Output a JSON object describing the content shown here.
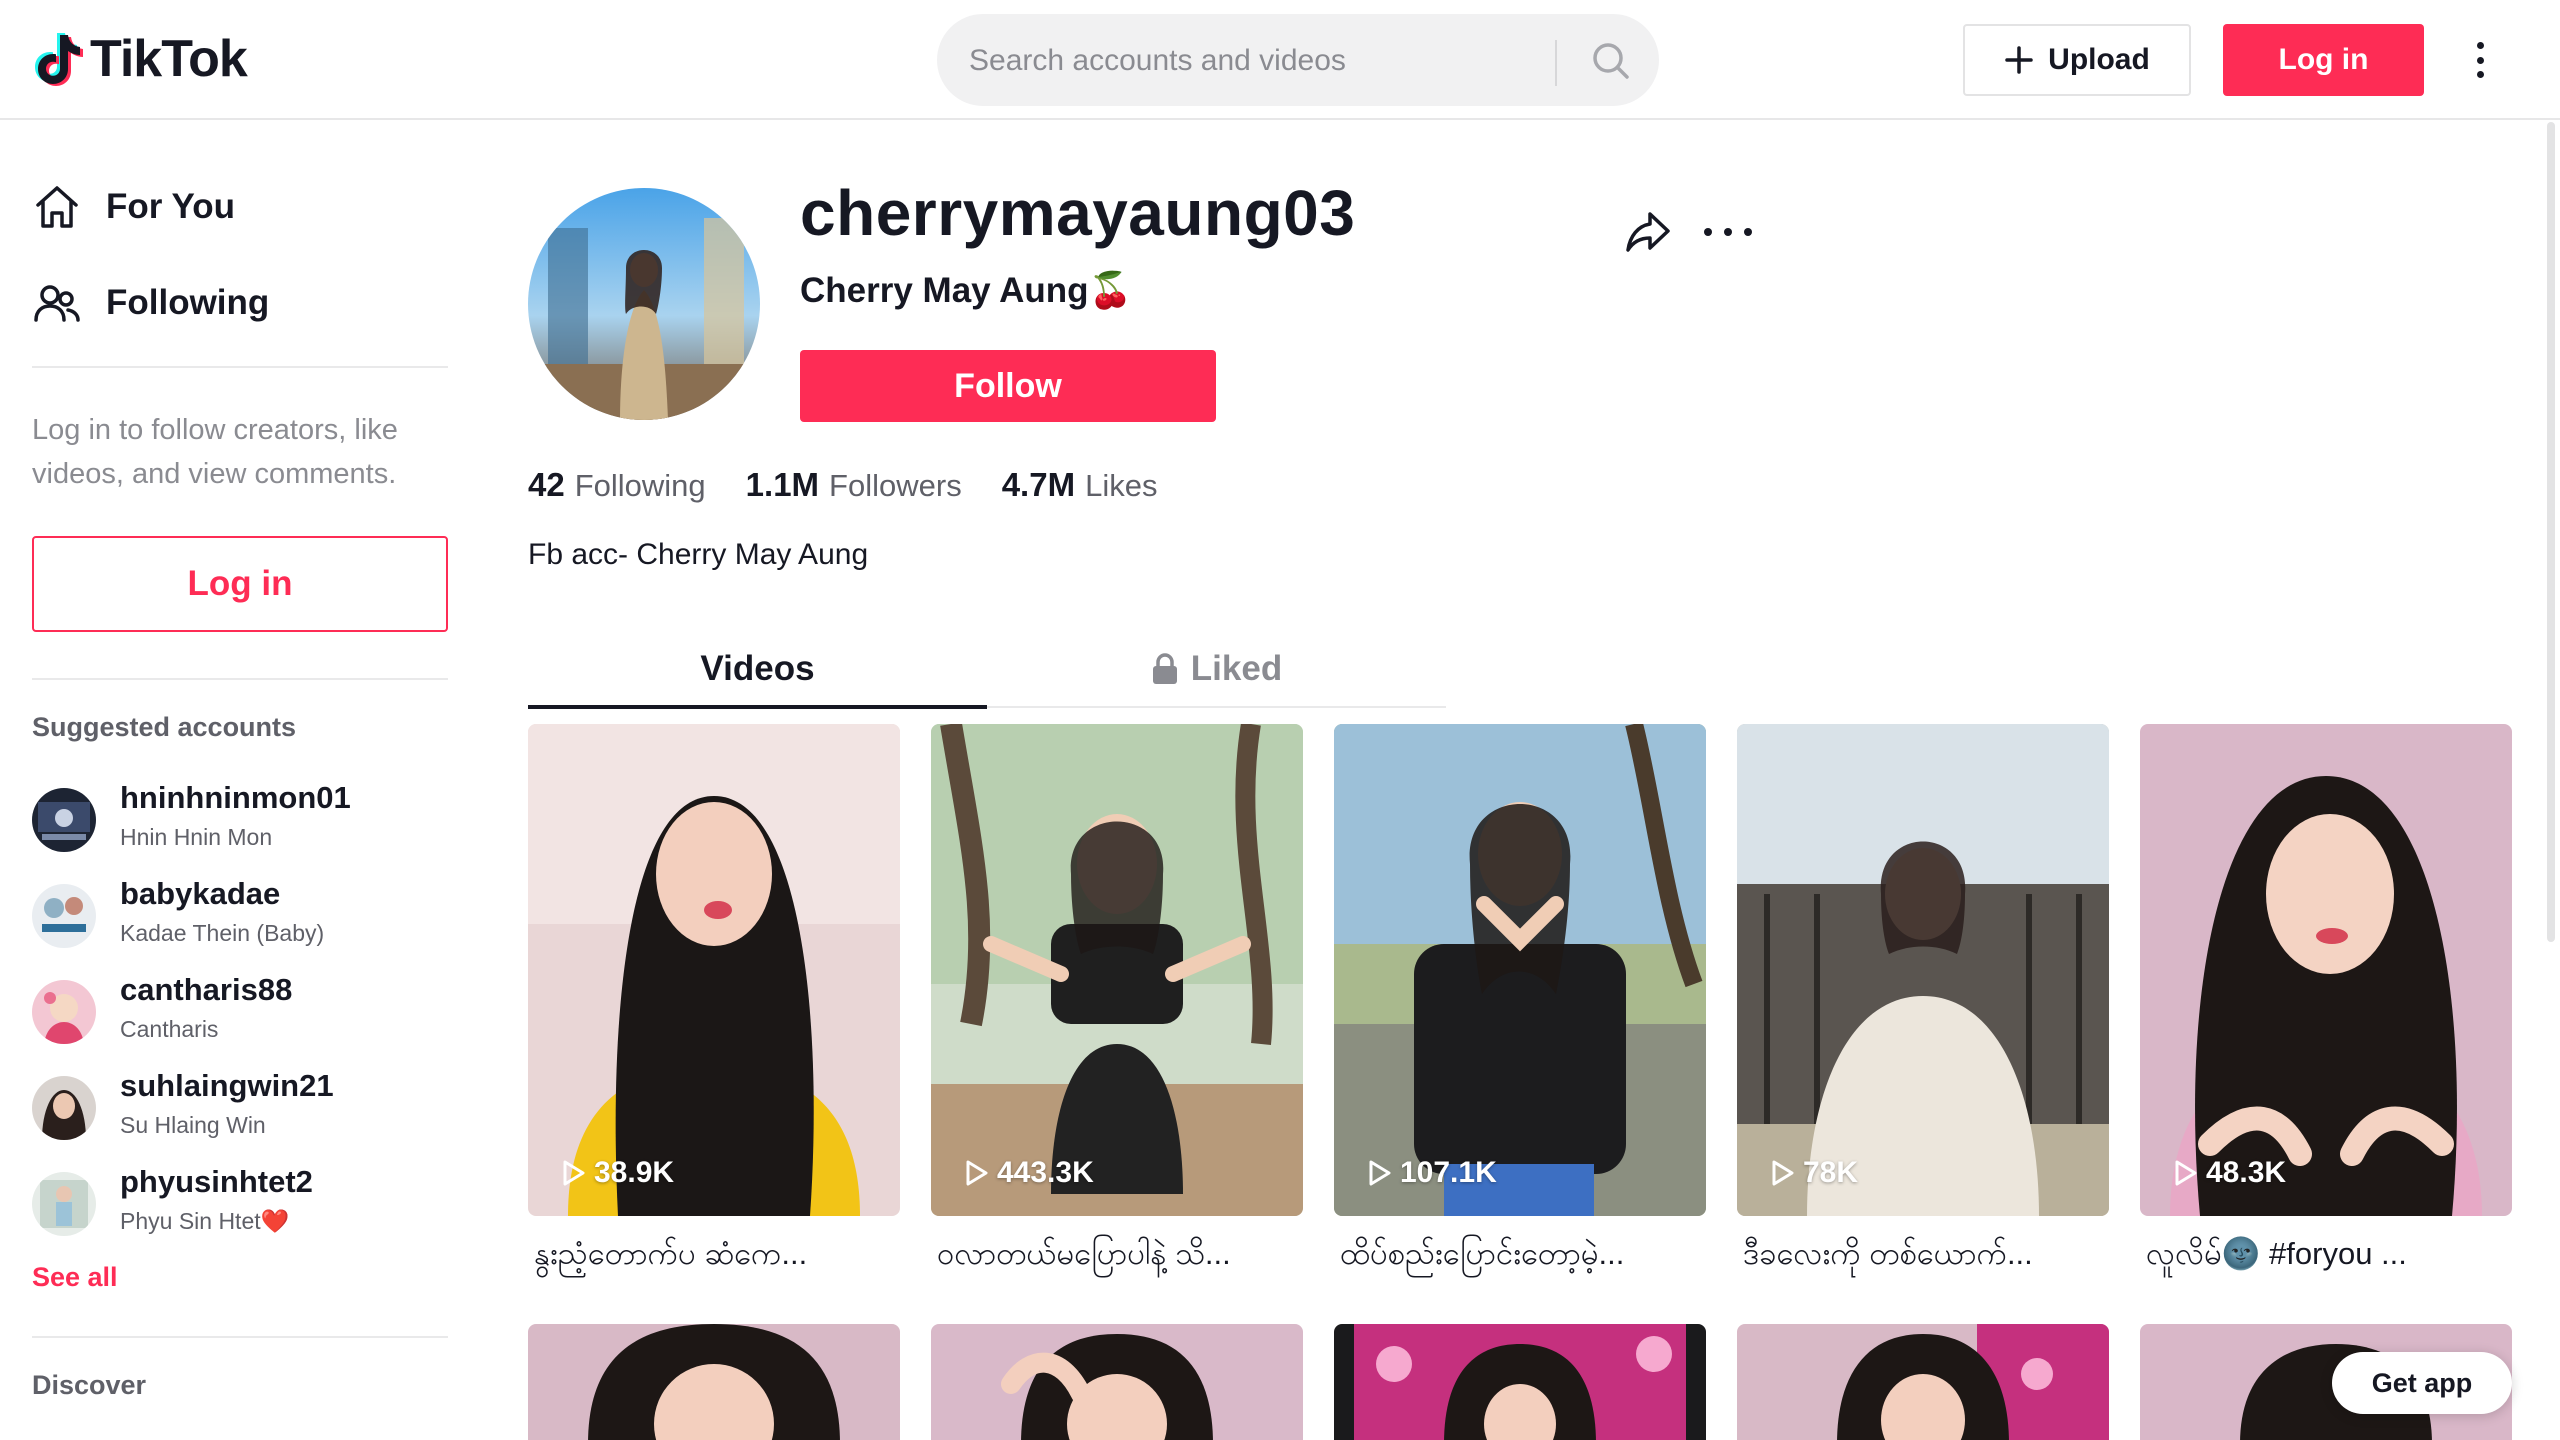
{
  "header": {
    "logo_text": "TikTok",
    "search_placeholder": "Search accounts and videos",
    "upload_label": "Upload",
    "login_label": "Log in"
  },
  "sidebar": {
    "nav": [
      {
        "label": "For You",
        "icon": "home-icon"
      },
      {
        "label": "Following",
        "icon": "people-icon"
      }
    ],
    "login_hint": "Log in to follow creators, like videos, and view comments.",
    "login_label": "Log in",
    "suggested_title": "Suggested accounts",
    "accounts": [
      {
        "username": "hninhninmon01",
        "name": "Hnin Hnin Mon"
      },
      {
        "username": "babykadae",
        "name": "Kadae Thein (Baby)"
      },
      {
        "username": "cantharis88",
        "name": "Cantharis"
      },
      {
        "username": "suhlaingwin21",
        "name": "Su Hlaing Win"
      },
      {
        "username": "phyusinhtet2",
        "name": "Phyu Sin Htet❤️"
      }
    ],
    "see_all": "See all",
    "discover": "Discover"
  },
  "profile": {
    "username": "cherrymayaung03",
    "nickname": "Cherry May Aung🍒",
    "follow_label": "Follow",
    "stats": [
      {
        "value": "42",
        "label": "Following"
      },
      {
        "value": "1.1M",
        "label": "Followers"
      },
      {
        "value": "4.7M",
        "label": "Likes"
      }
    ],
    "bio": "Fb acc- Cherry May Aung"
  },
  "tabs": {
    "videos": "Videos",
    "liked": "Liked"
  },
  "videos": [
    {
      "views": "38.9K",
      "caption": "နွးညံ့တောက်ပ ဆံကေ..."
    },
    {
      "views": "443.3K",
      "caption": "ဝလာတယ်မပြောပါနဲ့ သိ..."
    },
    {
      "views": "107.1K",
      "caption": "ထိပ်စည်းပြောင်းတော့မဲ့..."
    },
    {
      "views": "78K",
      "caption": "ဒီခလေးကို တစ်ယောက်..."
    },
    {
      "views": "48.3K",
      "caption": "လူလိမ်🌚 #foryou ..."
    }
  ],
  "get_app": "Get app",
  "colors": {
    "brand": "#fe2c55",
    "text": "#161823",
    "muted": "#8a8b91"
  }
}
